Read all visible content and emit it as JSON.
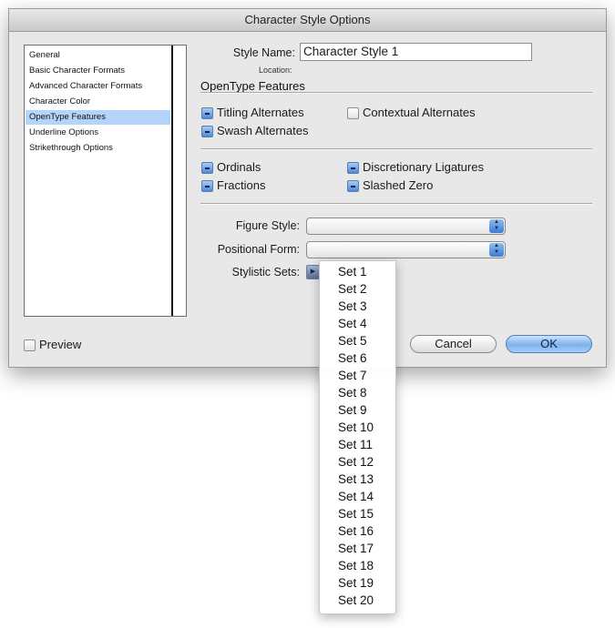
{
  "window": {
    "title": "Character Style Options"
  },
  "sidebar": {
    "items": [
      {
        "label": "General",
        "selected": false
      },
      {
        "label": "Basic Character Formats",
        "selected": false
      },
      {
        "label": "Advanced Character Formats",
        "selected": false
      },
      {
        "label": "Character Color",
        "selected": false
      },
      {
        "label": "OpenType Features",
        "selected": true
      },
      {
        "label": "Underline Options",
        "selected": false
      },
      {
        "label": "Strikethrough Options",
        "selected": false
      }
    ]
  },
  "style": {
    "name_label": "Style Name:",
    "name_value": "Character Style 1",
    "location_label": "Location:"
  },
  "section": {
    "title": "OpenType Features"
  },
  "features": {
    "titling_alternates": {
      "label": "Titling Alternates",
      "state": "mixed"
    },
    "contextual_alternates": {
      "label": "Contextual Alternates",
      "state": "unchecked"
    },
    "swash_alternates": {
      "label": "Swash Alternates",
      "state": "mixed"
    },
    "ordinals": {
      "label": "Ordinals",
      "state": "mixed"
    },
    "discretionary_ligatures": {
      "label": "Discretionary Ligatures",
      "state": "mixed"
    },
    "fractions": {
      "label": "Fractions",
      "state": "mixed"
    },
    "slashed_zero": {
      "label": "Slashed Zero",
      "state": "mixed"
    }
  },
  "figure_style": {
    "label": "Figure Style:",
    "value": ""
  },
  "positional_form": {
    "label": "Positional Form:",
    "value": ""
  },
  "stylistic_sets": {
    "label": "Stylistic Sets:",
    "menu": [
      "Set 1",
      "Set 2",
      "Set 3",
      "Set 4",
      "Set 5",
      "Set 6",
      "Set 7",
      "Set 8",
      "Set 9",
      "Set 10",
      "Set 11",
      "Set 12",
      "Set 13",
      "Set 14",
      "Set 15",
      "Set 16",
      "Set 17",
      "Set 18",
      "Set 19",
      "Set 20"
    ]
  },
  "preview": {
    "label": "Preview",
    "checked": false
  },
  "buttons": {
    "cancel": "Cancel",
    "ok": "OK"
  },
  "icons": {
    "select_arrows": "up-down-arrows-icon",
    "menu_trigger": "triangle-right-icon",
    "checkbox_mixed": "minus-icon"
  },
  "colors": {
    "accent": "#5b9be6",
    "selection": "#b5d4fb"
  }
}
